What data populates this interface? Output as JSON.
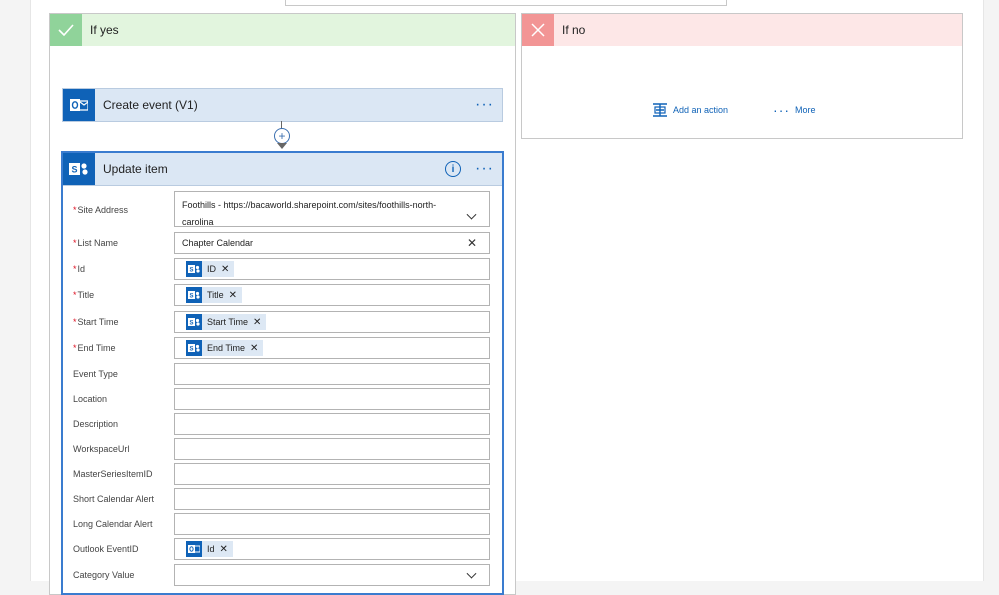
{
  "branches": {
    "yes": {
      "title": "If yes",
      "color": "#e2f5de"
    },
    "no": {
      "title": "If no",
      "color": "#fde7e7"
    }
  },
  "create_event": {
    "title": "Create event (V1)",
    "icon": "outlook-icon",
    "more": "···"
  },
  "update_item": {
    "title": "Update item",
    "icon": "sharepoint-icon",
    "more": "···",
    "fields": {
      "site_address": {
        "label": "Site Address",
        "required": true,
        "value_line1": "Foothills - https://bacaworld.sharepoint.com/sites/foothills-north-",
        "value_line2": "carolina"
      },
      "list_name": {
        "label": "List Name",
        "required": true,
        "value": "Chapter Calendar"
      },
      "id": {
        "label": "Id",
        "required": true,
        "token": "ID"
      },
      "title": {
        "label": "Title",
        "required": true,
        "token": "Title"
      },
      "start_time": {
        "label": "Start Time",
        "required": true,
        "token": "Start Time"
      },
      "end_time": {
        "label": "End Time",
        "required": true,
        "token": "End Time"
      },
      "event_type": {
        "label": "Event Type",
        "required": false,
        "value": ""
      },
      "location": {
        "label": "Location",
        "required": false,
        "value": ""
      },
      "description": {
        "label": "Description",
        "required": false,
        "value": ""
      },
      "workspace_url": {
        "label": "WorkspaceUrl",
        "required": false,
        "value": ""
      },
      "master_series_item_id": {
        "label": "MasterSeriesItemID",
        "required": false,
        "value": ""
      },
      "short_calendar_alert": {
        "label": "Short Calendar Alert",
        "required": false,
        "value": ""
      },
      "long_calendar_alert": {
        "label": "Long Calendar Alert",
        "required": false,
        "value": ""
      },
      "outlook_event_id": {
        "label": "Outlook EventID",
        "required": false,
        "token": "Id"
      },
      "category_value": {
        "label": "Category Value",
        "required": false,
        "value": ""
      }
    }
  },
  "no_branch_actions": {
    "add_action": "Add an action",
    "more": "More"
  },
  "colors": {
    "accent": "#0f62b7",
    "sharepoint": "#0f62b7",
    "outlook": "#0f62b7"
  }
}
